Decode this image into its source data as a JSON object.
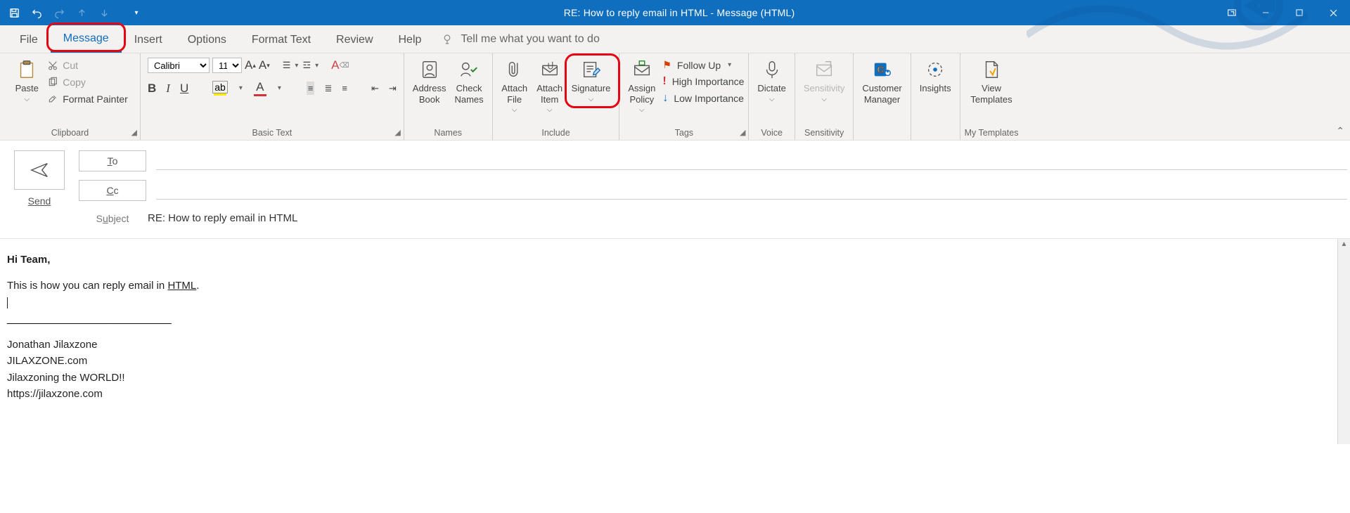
{
  "window": {
    "title": "RE: How to reply email in HTML  -  Message (HTML)"
  },
  "tabs": {
    "file": "File",
    "message": "Message",
    "insert": "Insert",
    "options": "Options",
    "format_text": "Format Text",
    "review": "Review",
    "help": "Help",
    "tellme": "Tell me what you want to do"
  },
  "ribbon": {
    "clipboard": {
      "paste": "Paste",
      "cut": "Cut",
      "copy": "Copy",
      "format_painter": "Format Painter",
      "label": "Clipboard"
    },
    "basic_text": {
      "font": "Calibri",
      "size": "11",
      "label": "Basic Text"
    },
    "names": {
      "address_book": "Address Book",
      "check_names": "Check Names",
      "label": "Names"
    },
    "include": {
      "attach_file": "Attach File",
      "attach_item": "Attach Item",
      "signature": "Signature",
      "label": "Include"
    },
    "assign": {
      "assign_policy": "Assign Policy"
    },
    "tags": {
      "follow_up": "Follow Up",
      "high": "High Importance",
      "low": "Low Importance",
      "label": "Tags"
    },
    "voice": {
      "dictate": "Dictate",
      "label": "Voice"
    },
    "sensitivity": {
      "btn": "Sensitivity",
      "label": "Sensitivity"
    },
    "customer_mgr": {
      "btn": "Customer Manager"
    },
    "insights": {
      "btn": "Insights"
    },
    "view_templates": {
      "btn": "View Templates",
      "label": "My Templates"
    }
  },
  "compose": {
    "send": "Send",
    "to_label": "To",
    "cc_label": "Cc",
    "subject_label": "Subject",
    "subject_value": "RE: How to reply email in HTML"
  },
  "body": {
    "greeting": "Hi Team,",
    "line1_a": "This is how you can reply email in ",
    "line1_b": "HTML",
    "line1_c": ".",
    "hr": "____________________________",
    "sig1": "Jonathan Jilaxzone",
    "sig2": "JILAXZONE.com",
    "sig3": "Jilaxzoning the WORLD!!",
    "sig4": "https://jilaxzone.com"
  }
}
